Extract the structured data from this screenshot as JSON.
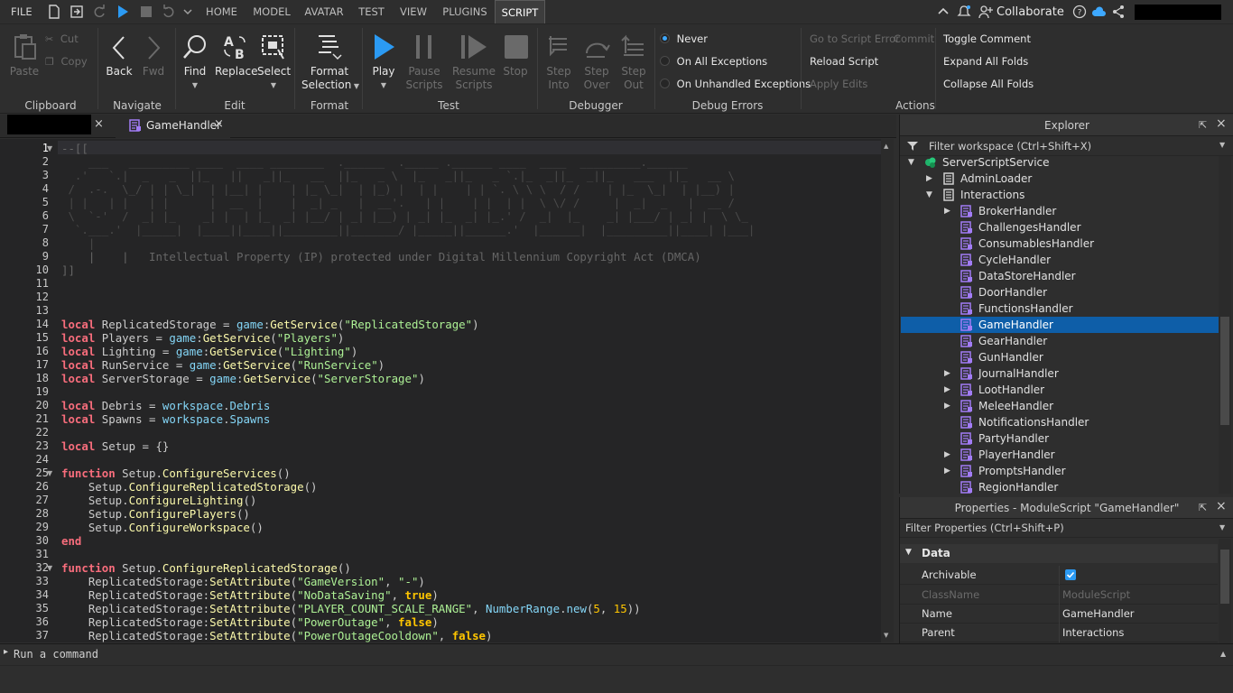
{
  "menubar": {
    "file": "FILE",
    "tabs": [
      "HOME",
      "MODEL",
      "AVATAR",
      "TEST",
      "VIEW",
      "PLUGINS",
      "SCRIPT"
    ],
    "active_tab": "SCRIPT",
    "collaborate": "Collaborate"
  },
  "ribbon": {
    "clipboard": {
      "paste": "Paste",
      "cut": "Cut",
      "copy": "Copy",
      "group": "Clipboard"
    },
    "navigate": {
      "back": "Back",
      "fwd": "Fwd",
      "group": "Navigate"
    },
    "edit": {
      "find": "Find",
      "replace": "Replace",
      "select": "Select",
      "group": "Edit"
    },
    "format": {
      "format_selection_1": "Format",
      "format_selection_2": "Selection",
      "group": "Format"
    },
    "test": {
      "play": "Play",
      "pause_1": "Pause",
      "pause_2": "Scripts",
      "resume_1": "Resume",
      "resume_2": "Scripts",
      "stop": "Stop",
      "group": "Test"
    },
    "debugger": {
      "step_into_1": "Step",
      "step_into_2": "Into",
      "step_over_1": "Step",
      "step_over_2": "Over",
      "step_out_1": "Step",
      "step_out_2": "Out",
      "group": "Debugger"
    },
    "debug_errors": {
      "never": "Never",
      "all": "On All Exceptions",
      "unhandled": "On Unhandled Exceptions",
      "group": "Debug Errors"
    },
    "actions": {
      "goto_error": "Go to Script Error",
      "commit": "Commit",
      "reload": "Reload Script",
      "apply_edits": "Apply Edits",
      "toggle_comment": "Toggle Comment",
      "expand_folds": "Expand All Folds",
      "collapse_folds": "Collapse All Folds",
      "group": "Actions"
    }
  },
  "editor": {
    "tab_label": "GameHandler",
    "comment_notice": "Intellectual Property (IP) protected under Digital Millennium Copyright Act (DMCA)"
  },
  "command_bar": {
    "placeholder": "Run a command"
  },
  "explorer": {
    "title": "Explorer",
    "filter": "Filter workspace (Ctrl+Shift+X)",
    "items": [
      {
        "label": "ServerScriptService"
      },
      {
        "label": "AdminLoader"
      },
      {
        "label": "Interactions"
      },
      {
        "label": "BrokerHandler"
      },
      {
        "label": "ChallengesHandler"
      },
      {
        "label": "ConsumablesHandler"
      },
      {
        "label": "CycleHandler"
      },
      {
        "label": "DataStoreHandler"
      },
      {
        "label": "DoorHandler"
      },
      {
        "label": "FunctionsHandler"
      },
      {
        "label": "GameHandler"
      },
      {
        "label": "GearHandler"
      },
      {
        "label": "GunHandler"
      },
      {
        "label": "JournalHandler"
      },
      {
        "label": "LootHandler"
      },
      {
        "label": "MeleeHandler"
      },
      {
        "label": "NotificationsHandler"
      },
      {
        "label": "PartyHandler"
      },
      {
        "label": "PlayerHandler"
      },
      {
        "label": "PromptsHandler"
      },
      {
        "label": "RegionHandler"
      }
    ]
  },
  "properties": {
    "title": "Properties - ModuleScript \"GameHandler\"",
    "filter": "Filter Properties (Ctrl+Shift+P)",
    "section": "Data",
    "rows": [
      {
        "name": "Archivable",
        "value": ""
      },
      {
        "name": "ClassName",
        "value": "ModuleScript"
      },
      {
        "name": "Name",
        "value": "GameHandler"
      },
      {
        "name": "Parent",
        "value": "Interactions"
      }
    ]
  },
  "colors": {
    "accent": "#0e5ea8",
    "play": "#2b9af3",
    "keyword": "#f86d7c",
    "string": "#adf195",
    "method": "#fdfbac",
    "global": "#84d6f7",
    "script_icon": "#a27cf6"
  }
}
